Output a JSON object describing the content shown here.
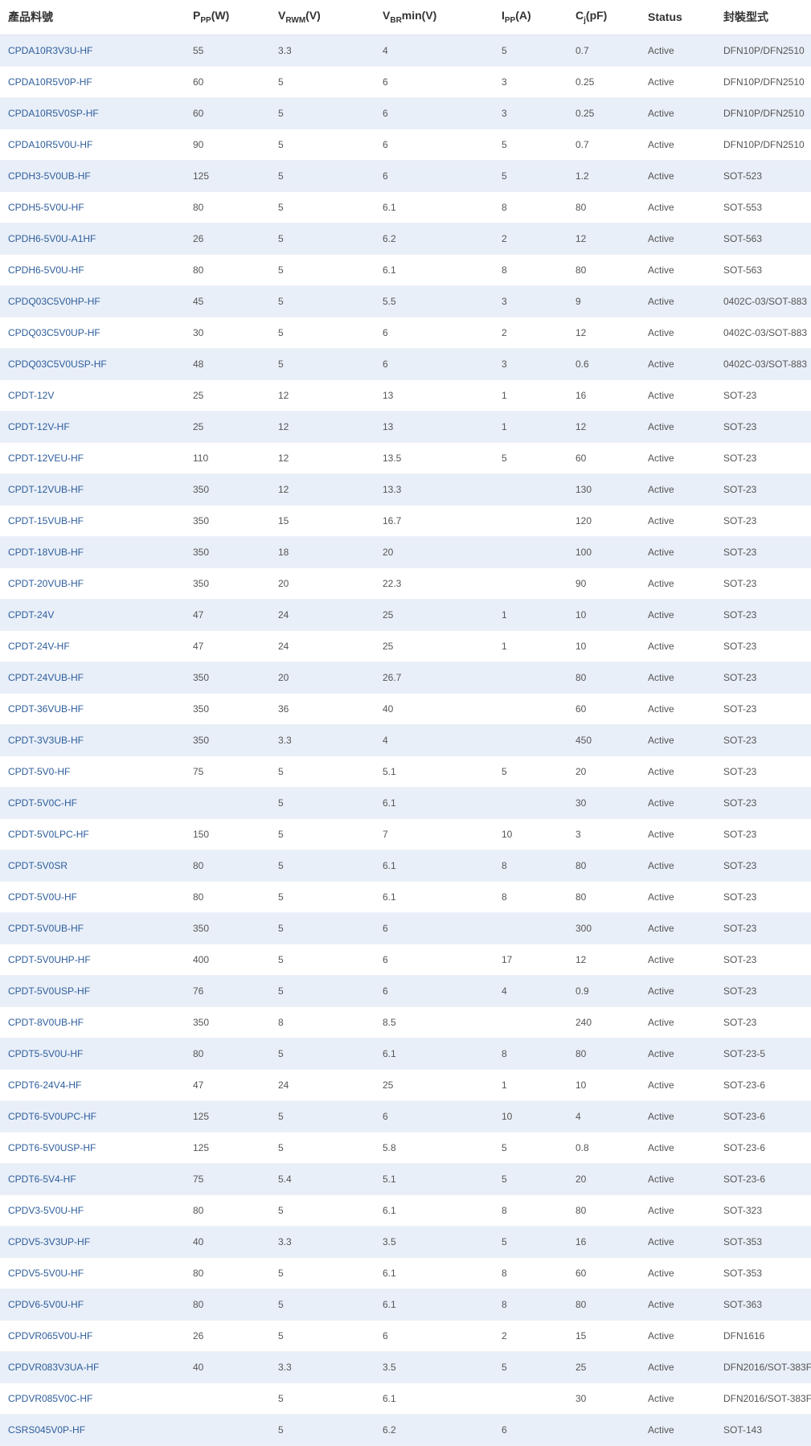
{
  "table": {
    "headers": {
      "part": "產品料號",
      "ppp": {
        "main": "P",
        "sub": "PP",
        "unit": "(W)"
      },
      "vrwm": {
        "main": "V",
        "sub": "RWM",
        "unit": "(V)"
      },
      "vbr": {
        "main": "V",
        "sub": "BR",
        "unit": "min(V)"
      },
      "ipp": {
        "main": "I",
        "sub": "PP",
        "unit": "(A)"
      },
      "cj": {
        "main": "C",
        "sub": "j",
        "unit": "(pF)"
      },
      "status": "Status",
      "package": "封裝型式"
    },
    "rows": [
      {
        "part": "CPDA10R3V3U-HF",
        "ppp": "55",
        "vrwm": "3.3",
        "vbr": "4",
        "ipp": "5",
        "cj": "0.7",
        "status": "Active",
        "package": "DFN10P/DFN2510"
      },
      {
        "part": "CPDA10R5V0P-HF",
        "ppp": "60",
        "vrwm": "5",
        "vbr": "6",
        "ipp": "3",
        "cj": "0.25",
        "status": "Active",
        "package": "DFN10P/DFN2510"
      },
      {
        "part": "CPDA10R5V0SP-HF",
        "ppp": "60",
        "vrwm": "5",
        "vbr": "6",
        "ipp": "3",
        "cj": "0.25",
        "status": "Active",
        "package": "DFN10P/DFN2510"
      },
      {
        "part": "CPDA10R5V0U-HF",
        "ppp": "90",
        "vrwm": "5",
        "vbr": "6",
        "ipp": "5",
        "cj": "0.7",
        "status": "Active",
        "package": "DFN10P/DFN2510"
      },
      {
        "part": "CPDH3-5V0UB-HF",
        "ppp": "125",
        "vrwm": "5",
        "vbr": "6",
        "ipp": "5",
        "cj": "1.2",
        "status": "Active",
        "package": "SOT-523"
      },
      {
        "part": "CPDH5-5V0U-HF",
        "ppp": "80",
        "vrwm": "5",
        "vbr": "6.1",
        "ipp": "8",
        "cj": "80",
        "status": "Active",
        "package": "SOT-553"
      },
      {
        "part": "CPDH6-5V0U-A1HF",
        "ppp": "26",
        "vrwm": "5",
        "vbr": "6.2",
        "ipp": "2",
        "cj": "12",
        "status": "Active",
        "package": "SOT-563"
      },
      {
        "part": "CPDH6-5V0U-HF",
        "ppp": "80",
        "vrwm": "5",
        "vbr": "6.1",
        "ipp": "8",
        "cj": "80",
        "status": "Active",
        "package": "SOT-563"
      },
      {
        "part": "CPDQ03C5V0HP-HF",
        "ppp": "45",
        "vrwm": "5",
        "vbr": "5.5",
        "ipp": "3",
        "cj": "9",
        "status": "Active",
        "package": "0402C-03/SOT-883"
      },
      {
        "part": "CPDQ03C5V0UP-HF",
        "ppp": "30",
        "vrwm": "5",
        "vbr": "6",
        "ipp": "2",
        "cj": "12",
        "status": "Active",
        "package": "0402C-03/SOT-883"
      },
      {
        "part": "CPDQ03C5V0USP-HF",
        "ppp": "48",
        "vrwm": "5",
        "vbr": "6",
        "ipp": "3",
        "cj": "0.6",
        "status": "Active",
        "package": "0402C-03/SOT-883"
      },
      {
        "part": "CPDT-12V",
        "ppp": "25",
        "vrwm": "12",
        "vbr": "13",
        "ipp": "1",
        "cj": "16",
        "status": "Active",
        "package": "SOT-23"
      },
      {
        "part": "CPDT-12V-HF",
        "ppp": "25",
        "vrwm": "12",
        "vbr": "13",
        "ipp": "1",
        "cj": "12",
        "status": "Active",
        "package": "SOT-23"
      },
      {
        "part": "CPDT-12VEU-HF",
        "ppp": "110",
        "vrwm": "12",
        "vbr": "13.5",
        "ipp": "5",
        "cj": "60",
        "status": "Active",
        "package": "SOT-23"
      },
      {
        "part": "CPDT-12VUB-HF",
        "ppp": "350",
        "vrwm": "12",
        "vbr": "13.3",
        "ipp": "",
        "cj": "130",
        "status": "Active",
        "package": "SOT-23"
      },
      {
        "part": "CPDT-15VUB-HF",
        "ppp": "350",
        "vrwm": "15",
        "vbr": "16.7",
        "ipp": "",
        "cj": "120",
        "status": "Active",
        "package": "SOT-23"
      },
      {
        "part": "CPDT-18VUB-HF",
        "ppp": "350",
        "vrwm": "18",
        "vbr": "20",
        "ipp": "",
        "cj": "100",
        "status": "Active",
        "package": "SOT-23"
      },
      {
        "part": "CPDT-20VUB-HF",
        "ppp": "350",
        "vrwm": "20",
        "vbr": "22.3",
        "ipp": "",
        "cj": "90",
        "status": "Active",
        "package": "SOT-23"
      },
      {
        "part": "CPDT-24V",
        "ppp": "47",
        "vrwm": "24",
        "vbr": "25",
        "ipp": "1",
        "cj": "10",
        "status": "Active",
        "package": "SOT-23"
      },
      {
        "part": "CPDT-24V-HF",
        "ppp": "47",
        "vrwm": "24",
        "vbr": "25",
        "ipp": "1",
        "cj": "10",
        "status": "Active",
        "package": "SOT-23"
      },
      {
        "part": "CPDT-24VUB-HF",
        "ppp": "350",
        "vrwm": "20",
        "vbr": "26.7",
        "ipp": "",
        "cj": "80",
        "status": "Active",
        "package": "SOT-23"
      },
      {
        "part": "CPDT-36VUB-HF",
        "ppp": "350",
        "vrwm": "36",
        "vbr": "40",
        "ipp": "",
        "cj": "60",
        "status": "Active",
        "package": "SOT-23"
      },
      {
        "part": "CPDT-3V3UB-HF",
        "ppp": "350",
        "vrwm": "3.3",
        "vbr": "4",
        "ipp": "",
        "cj": "450",
        "status": "Active",
        "package": "SOT-23"
      },
      {
        "part": "CPDT-5V0-HF",
        "ppp": "75",
        "vrwm": "5",
        "vbr": "5.1",
        "ipp": "5",
        "cj": "20",
        "status": "Active",
        "package": "SOT-23"
      },
      {
        "part": "CPDT-5V0C-HF",
        "ppp": "",
        "vrwm": "5",
        "vbr": "6.1",
        "ipp": "",
        "cj": "30",
        "status": "Active",
        "package": "SOT-23"
      },
      {
        "part": "CPDT-5V0LPC-HF",
        "ppp": "150",
        "vrwm": "5",
        "vbr": "7",
        "ipp": "10",
        "cj": "3",
        "status": "Active",
        "package": "SOT-23"
      },
      {
        "part": "CPDT-5V0SR",
        "ppp": "80",
        "vrwm": "5",
        "vbr": "6.1",
        "ipp": "8",
        "cj": "80",
        "status": "Active",
        "package": "SOT-23"
      },
      {
        "part": "CPDT-5V0U-HF",
        "ppp": "80",
        "vrwm": "5",
        "vbr": "6.1",
        "ipp": "8",
        "cj": "80",
        "status": "Active",
        "package": "SOT-23"
      },
      {
        "part": "CPDT-5V0UB-HF",
        "ppp": "350",
        "vrwm": "5",
        "vbr": "6",
        "ipp": "",
        "cj": "300",
        "status": "Active",
        "package": "SOT-23"
      },
      {
        "part": "CPDT-5V0UHP-HF",
        "ppp": "400",
        "vrwm": "5",
        "vbr": "6",
        "ipp": "17",
        "cj": "12",
        "status": "Active",
        "package": "SOT-23"
      },
      {
        "part": "CPDT-5V0USP-HF",
        "ppp": "76",
        "vrwm": "5",
        "vbr": "6",
        "ipp": "4",
        "cj": "0.9",
        "status": "Active",
        "package": "SOT-23"
      },
      {
        "part": "CPDT-8V0UB-HF",
        "ppp": "350",
        "vrwm": "8",
        "vbr": "8.5",
        "ipp": "",
        "cj": "240",
        "status": "Active",
        "package": "SOT-23"
      },
      {
        "part": "CPDT5-5V0U-HF",
        "ppp": "80",
        "vrwm": "5",
        "vbr": "6.1",
        "ipp": "8",
        "cj": "80",
        "status": "Active",
        "package": "SOT-23-5"
      },
      {
        "part": "CPDT6-24V4-HF",
        "ppp": "47",
        "vrwm": "24",
        "vbr": "25",
        "ipp": "1",
        "cj": "10",
        "status": "Active",
        "package": "SOT-23-6"
      },
      {
        "part": "CPDT6-5V0UPC-HF",
        "ppp": "125",
        "vrwm": "5",
        "vbr": "6",
        "ipp": "10",
        "cj": "4",
        "status": "Active",
        "package": "SOT-23-6"
      },
      {
        "part": "CPDT6-5V0USP-HF",
        "ppp": "125",
        "vrwm": "5",
        "vbr": "5.8",
        "ipp": "5",
        "cj": "0.8",
        "status": "Active",
        "package": "SOT-23-6"
      },
      {
        "part": "CPDT6-5V4-HF",
        "ppp": "75",
        "vrwm": "5.4",
        "vbr": "5.1",
        "ipp": "5",
        "cj": "20",
        "status": "Active",
        "package": "SOT-23-6"
      },
      {
        "part": "CPDV3-5V0U-HF",
        "ppp": "80",
        "vrwm": "5",
        "vbr": "6.1",
        "ipp": "8",
        "cj": "80",
        "status": "Active",
        "package": "SOT-323"
      },
      {
        "part": "CPDV5-3V3UP-HF",
        "ppp": "40",
        "vrwm": "3.3",
        "vbr": "3.5",
        "ipp": "5",
        "cj": "16",
        "status": "Active",
        "package": "SOT-353"
      },
      {
        "part": "CPDV5-5V0U-HF",
        "ppp": "80",
        "vrwm": "5",
        "vbr": "6.1",
        "ipp": "8",
        "cj": "60",
        "status": "Active",
        "package": "SOT-353"
      },
      {
        "part": "CPDV6-5V0U-HF",
        "ppp": "80",
        "vrwm": "5",
        "vbr": "6.1",
        "ipp": "8",
        "cj": "80",
        "status": "Active",
        "package": "SOT-363"
      },
      {
        "part": "CPDVR065V0U-HF",
        "ppp": "26",
        "vrwm": "5",
        "vbr": "6",
        "ipp": "2",
        "cj": "15",
        "status": "Active",
        "package": "DFN1616"
      },
      {
        "part": "CPDVR083V3UA-HF",
        "ppp": "40",
        "vrwm": "3.3",
        "vbr": "3.5",
        "ipp": "5",
        "cj": "25",
        "status": "Active",
        "package": "DFN2016/SOT-383F"
      },
      {
        "part": "CPDVR085V0C-HF",
        "ppp": "",
        "vrwm": "5",
        "vbr": "6.1",
        "ipp": "",
        "cj": "30",
        "status": "Active",
        "package": "DFN2016/SOT-383F"
      },
      {
        "part": "CSRS045V0P-HF",
        "ppp": "",
        "vrwm": "5",
        "vbr": "6.2",
        "ipp": "6",
        "cj": "",
        "status": "Active",
        "package": "SOT-143"
      }
    ]
  }
}
